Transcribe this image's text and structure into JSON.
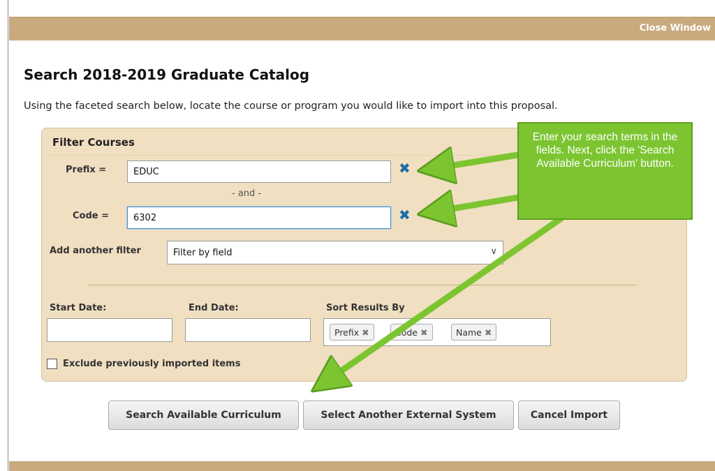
{
  "window": {
    "close_label": "Close Window"
  },
  "page": {
    "title": "Search 2018-2019 Graduate Catalog",
    "intro": "Using the faceted search below, locate the course or program you would like to import into this proposal."
  },
  "filter": {
    "title": "Filter Courses",
    "prefix_label": "Prefix =",
    "prefix_value": "EDUC",
    "and_text": "- and -",
    "code_label": "Code =",
    "code_value": "6302",
    "add_filter_label": "Add another filter",
    "add_filter_selected": "Filter by field",
    "clear_icon": "x-icon",
    "start_date_label": "Start Date:",
    "end_date_label": "End Date:",
    "sort_label": "Sort Results By",
    "sort_tags": [
      {
        "label": "Prefix"
      },
      {
        "label": "Code"
      },
      {
        "label": "Name"
      }
    ],
    "exclude_label": "Exclude previously imported items",
    "exclude_checked": false
  },
  "buttons": {
    "search": "Search Available Curriculum",
    "select_external": "Select Another External System",
    "cancel": "Cancel Import"
  },
  "callout": {
    "text": "Enter your search terms in the fields. Next, click the 'Search Available Curriculum' button."
  },
  "colors": {
    "header_bar": "#c9a97e",
    "panel_bg": "#f1dfc2",
    "callout_bg": "#7cc531",
    "clear_icon": "#1e6ea6"
  }
}
